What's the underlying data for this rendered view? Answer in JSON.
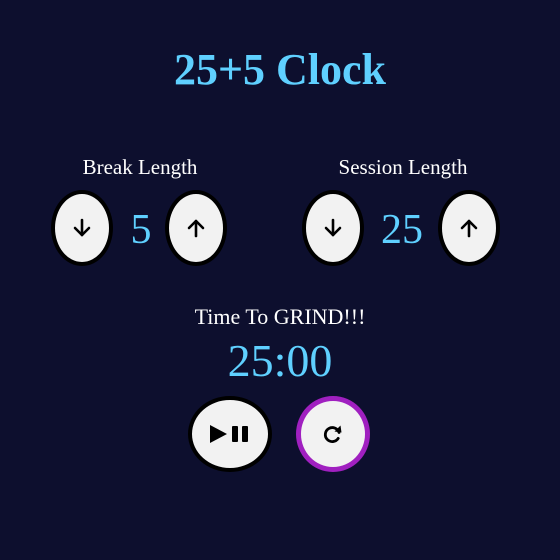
{
  "app": {
    "title": "25+5 Clock"
  },
  "break": {
    "label": "Break Length",
    "value": "5",
    "decrement_icon": "arrow-down-icon",
    "increment_icon": "arrow-up-icon"
  },
  "session": {
    "label": "Session Length",
    "value": "25",
    "decrement_icon": "arrow-down-icon",
    "increment_icon": "arrow-up-icon"
  },
  "timer": {
    "label": "Time To GRIND!!!",
    "display": "25:00",
    "play_pause_icon": "play-pause-icon",
    "reset_icon": "refresh-icon"
  },
  "colors": {
    "background": "#0d0f2e",
    "accent": "#5fd0ff",
    "reset_border": "#a020c0",
    "button_fill": "#f2f2f2"
  }
}
